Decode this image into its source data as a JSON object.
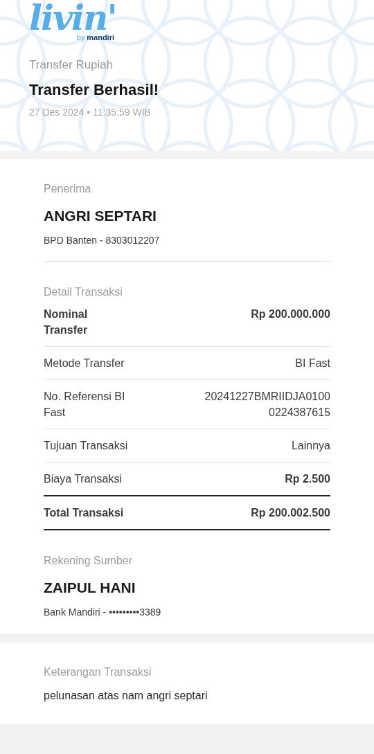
{
  "header": {
    "logo": {
      "wordmark": "livin'",
      "by": "by",
      "brand": "mandiri"
    },
    "category": "Transfer Rupiah",
    "title": "Transfer Berhasil!",
    "timestamp": "27 Des 2024 • 11:35:59 WIB"
  },
  "recipient": {
    "label": "Penerima",
    "name": "ANGRI SEPTARI",
    "account": "BPD Banten - 8303012207"
  },
  "details": {
    "label": "Detail Transaksi",
    "rows": [
      {
        "kind": "highlight",
        "label": "Nominal Transfer",
        "value": [
          "Rp 200.000.000"
        ]
      },
      {
        "kind": "plain",
        "label": "Metode Transfer",
        "value": [
          "BI Fast"
        ]
      },
      {
        "kind": "plain",
        "label": "No. Referensi BI Fast",
        "value": [
          "20241227BMRIIDJA0100",
          "0224387615"
        ]
      },
      {
        "kind": "plain",
        "label": "Tujuan Transaksi",
        "value": [
          "Lainnya"
        ]
      },
      {
        "kind": "fee",
        "label": "Biaya Transaksi",
        "value": [
          "Rp 2.500"
        ]
      },
      {
        "kind": "total",
        "label": "Total Transaksi",
        "value": [
          "Rp 200.002.500"
        ]
      }
    ]
  },
  "source": {
    "label": "Rekening Sumber",
    "name": "ZAIPUL HANI",
    "account": "Bank Mandiri - •••••••••3389"
  },
  "note": {
    "label": "Keterangan Transaksi",
    "text": "pelunasan atas nam angri septari"
  }
}
